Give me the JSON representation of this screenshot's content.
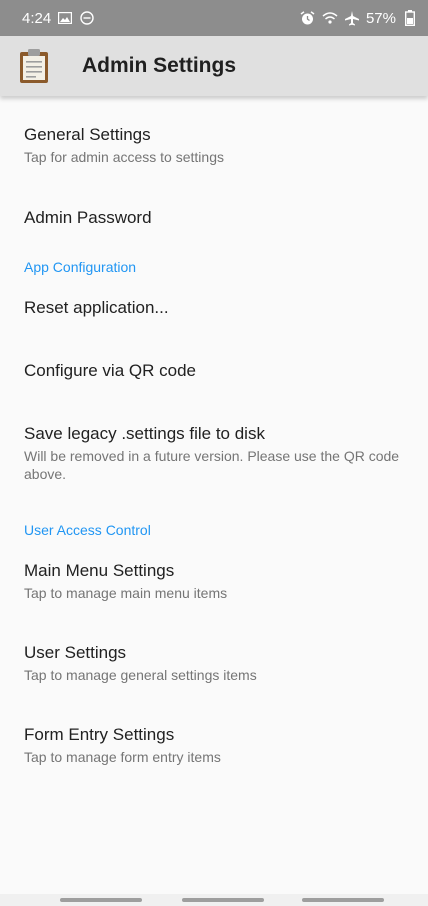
{
  "status_bar": {
    "time": "4:24",
    "battery": "57%"
  },
  "app_bar": {
    "title": "Admin Settings"
  },
  "items": [
    {
      "title": "General Settings",
      "summary": "Tap for admin access to settings"
    },
    {
      "title": "Admin Password"
    },
    {
      "title": "Reset application..."
    },
    {
      "title": "Configure via QR code"
    },
    {
      "title": "Save legacy .settings file to disk",
      "summary": "Will be removed in a future version. Please use the QR code above."
    },
    {
      "title": "Main Menu Settings",
      "summary": "Tap to manage main menu items"
    },
    {
      "title": "User Settings",
      "summary": "Tap to manage general settings items"
    },
    {
      "title": "Form Entry Settings",
      "summary": "Tap to manage form entry items"
    }
  ],
  "categories": {
    "app_configuration": "App Configuration",
    "user_access_control": "User Access Control"
  },
  "colors": {
    "accent": "#2196f3",
    "status_bar": "#8d8d8d",
    "app_bar": "#e0e0e0",
    "background": "#fafafa"
  }
}
